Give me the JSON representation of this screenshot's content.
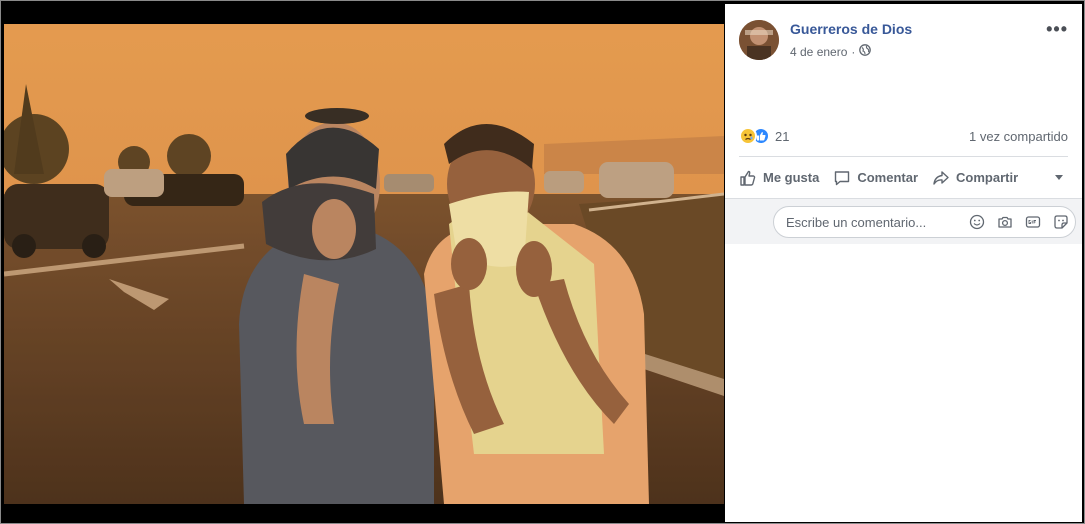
{
  "post": {
    "author": "Guerreros de Dios",
    "date": "4 de enero",
    "separator": "·",
    "privacy_icon": "globe-icon"
  },
  "stats": {
    "reaction_icons": [
      "sad-reaction-icon",
      "like-reaction-icon"
    ],
    "reaction_count": "21",
    "shares": "1 vez compartido"
  },
  "actions": {
    "like": "Me gusta",
    "comment": "Comentar",
    "share": "Compartir"
  },
  "comment": {
    "placeholder": "Escribe un comentario...",
    "icons": [
      "emoji-icon",
      "camera-icon",
      "gif-icon",
      "sticker-icon"
    ]
  },
  "colors": {
    "link_blue": "#385898",
    "sky_orange": "#e09a52",
    "like_blue": "#2d88ff"
  }
}
